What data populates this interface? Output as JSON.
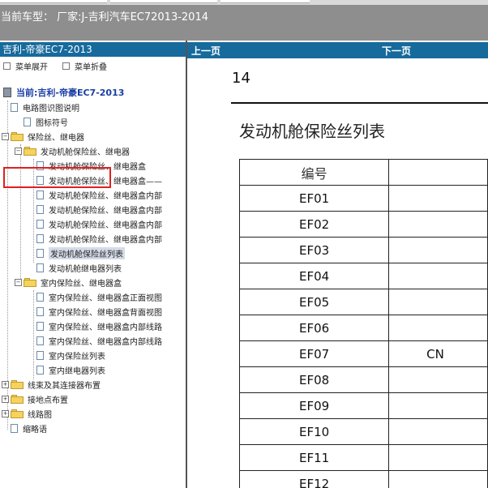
{
  "header": {
    "current_vehicle": "当前车型： 厂家:J-吉利汽车EC72013-2014"
  },
  "left_pane": {
    "title": "吉利-帝豪EC7-2013",
    "expand_menu": "菜单展开",
    "collapse_menu": "菜单折叠",
    "current": "当前:吉利-帝豪EC7-2013",
    "tree": [
      {
        "label": "电路图识图说明",
        "type": "doc"
      },
      {
        "label": "图标符号",
        "type": "doc"
      },
      {
        "label": "保险丝、继电器",
        "type": "folder"
      },
      {
        "label": "发动机舱保险丝、继电器",
        "type": "folder"
      },
      {
        "label": "发动机舱保险丝、继电器盒",
        "type": "doc"
      },
      {
        "label": "发动机舱保险丝、继电器盒——",
        "type": "doc"
      },
      {
        "label": "发动机舱保险丝、继电器盒内部",
        "type": "doc"
      },
      {
        "label": "发动机舱保险丝、继电器盒内部",
        "type": "doc"
      },
      {
        "label": "发动机舱保险丝、继电器盒内部",
        "type": "doc"
      },
      {
        "label": "发动机舱保险丝、继电器盒内部",
        "type": "doc"
      },
      {
        "label": "发动机舱保险丝列表",
        "type": "doc",
        "selected": true
      },
      {
        "label": "发动机舱继电器列表",
        "type": "doc"
      },
      {
        "label": "室内保险丝、继电器盒",
        "type": "folder"
      },
      {
        "label": "室内保险丝、继电器盒正面视图",
        "type": "doc"
      },
      {
        "label": "室内保险丝、继电器盒背面视图",
        "type": "doc"
      },
      {
        "label": "室内保险丝、继电器盒内部线路",
        "type": "doc"
      },
      {
        "label": "室内保险丝、继电器盒内部线路",
        "type": "doc"
      },
      {
        "label": "室内保险丝列表",
        "type": "doc"
      },
      {
        "label": "室内继电器列表",
        "type": "doc"
      },
      {
        "label": "线束及其连接器布置",
        "type": "folder"
      },
      {
        "label": "接地点布置",
        "type": "folder"
      },
      {
        "label": "线路图",
        "type": "folder"
      },
      {
        "label": "缩略语",
        "type": "doc"
      }
    ]
  },
  "document": {
    "prev_page": "上一页",
    "next_page": "下一页",
    "page_number": "14",
    "title": "发动机舱保险丝列表",
    "table": {
      "header": "编号",
      "rows": [
        {
          "code": "EF01",
          "col2": ""
        },
        {
          "code": "EF02",
          "col2": ""
        },
        {
          "code": "EF03",
          "col2": ""
        },
        {
          "code": "EF04",
          "col2": ""
        },
        {
          "code": "EF05",
          "col2": ""
        },
        {
          "code": "EF06",
          "col2": ""
        },
        {
          "code": "EF07",
          "col2": "CN"
        },
        {
          "code": "EF08",
          "col2": ""
        },
        {
          "code": "EF09",
          "col2": ""
        },
        {
          "code": "EF10",
          "col2": ""
        },
        {
          "code": "EF11",
          "col2": ""
        },
        {
          "code": "EF12",
          "col2": ""
        }
      ]
    }
  }
}
